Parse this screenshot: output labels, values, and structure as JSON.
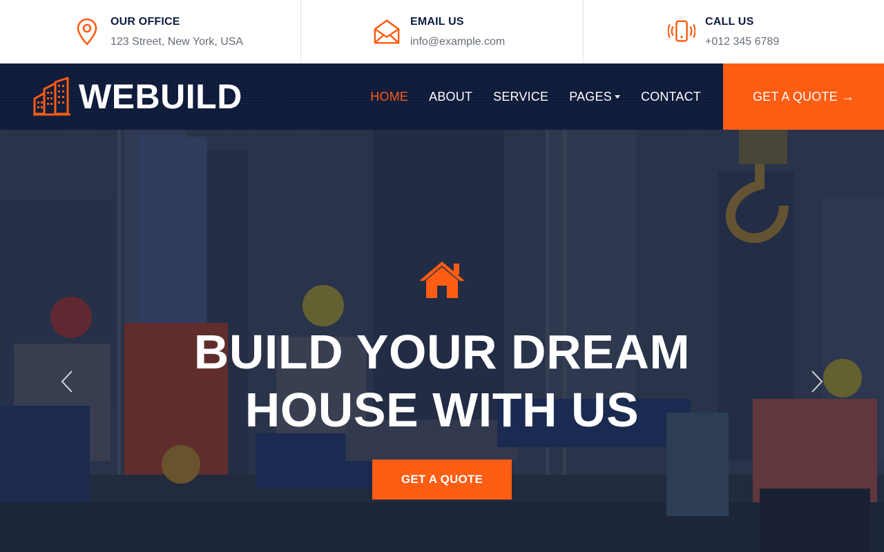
{
  "topbar": {
    "office": {
      "label": "OUR OFFICE",
      "value": "123 Street, New York, USA",
      "icon": "map-pin-icon"
    },
    "email": {
      "label": "EMAIL US",
      "value": "info@example.com",
      "icon": "envelope-icon"
    },
    "call": {
      "label": "CALL US",
      "value": "+012 345 6789",
      "icon": "phone-ringing-icon"
    }
  },
  "navbar": {
    "brand": "WEBUILD",
    "logo_icon": "building-icon",
    "items": [
      {
        "label": "HOME",
        "active": true
      },
      {
        "label": "ABOUT",
        "active": false
      },
      {
        "label": "SERVICE",
        "active": false
      },
      {
        "label": "PAGES",
        "active": false,
        "dropdown": true
      },
      {
        "label": "CONTACT",
        "active": false
      }
    ],
    "quote_button": "GET A QUOTE",
    "quote_arrow": "→"
  },
  "hero": {
    "icon": "house-icon",
    "title_line1": "BUILD YOUR DREAM",
    "title_line2": "HOUSE WITH US",
    "button": "GET A QUOTE",
    "prev_icon": "chevron-left-icon",
    "next_icon": "chevron-right-icon"
  },
  "colors": {
    "accent": "#fe5d14",
    "navy": "#0e1a39",
    "text_dark": "#0b1b3f",
    "text_muted": "#666d78"
  }
}
